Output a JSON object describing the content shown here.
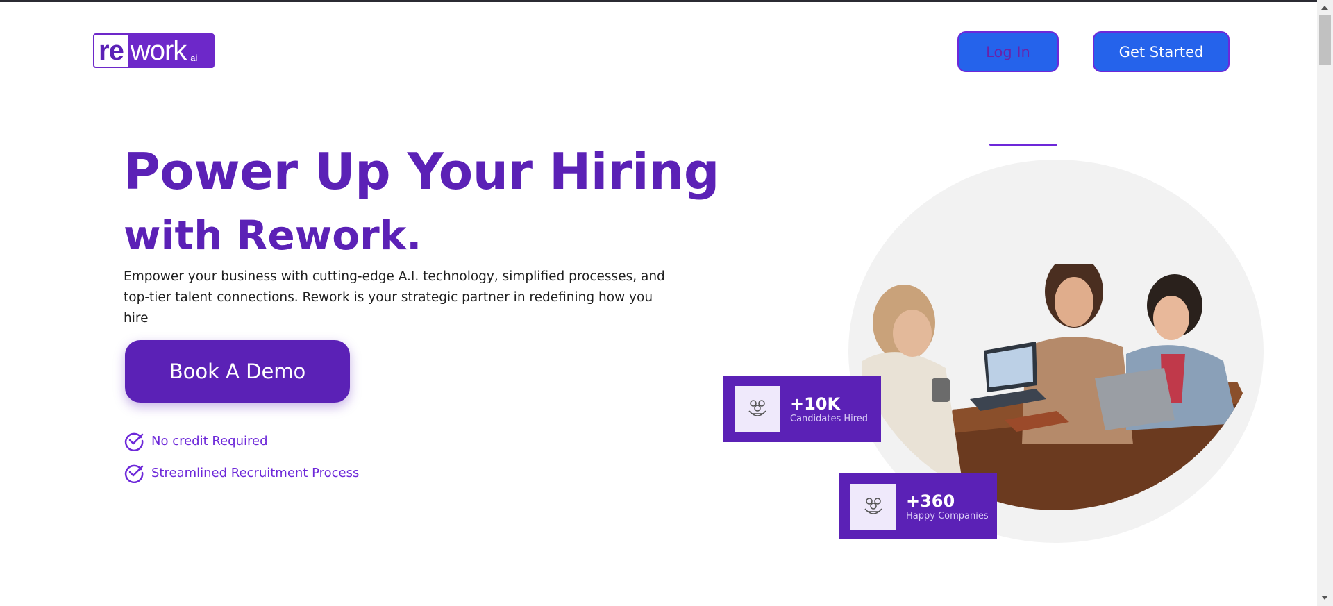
{
  "logo": {
    "re": "re",
    "work": "work",
    "ai": "ai"
  },
  "nav": {
    "login_label": "Log In",
    "get_started_label": "Get Started"
  },
  "hero": {
    "title": "Power Up Your Hiring",
    "subtitle": "with Rework.",
    "description": "Empower your business with cutting-edge A.I. technology, simplified processes, and top-tier talent connections. Rework is your strategic partner in redefining how you hire",
    "cta_label": "Book A Demo",
    "checks": [
      "No credit Required",
      "Streamlined Recruitment Process"
    ]
  },
  "stats": [
    {
      "value": "+10K",
      "label": "Candidates Hired",
      "icon": "group-icon"
    },
    {
      "value": "+360",
      "label": "Happy Companies",
      "icon": "group-icon"
    }
  ],
  "colors": {
    "brand_purple": "#5b21b6",
    "button_blue": "#2563eb",
    "check_purple": "#6d28d9"
  }
}
